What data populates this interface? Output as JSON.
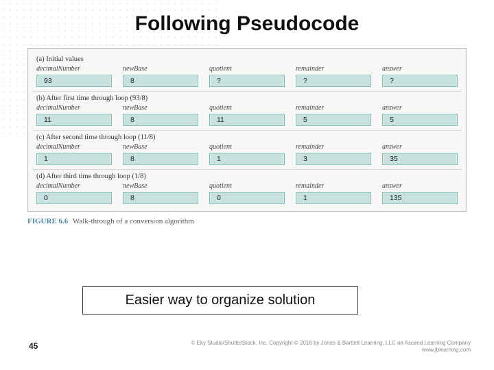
{
  "title": "Following Pseudocode",
  "figure": {
    "columns": [
      "decimalNumber",
      "newBase",
      "quotient",
      "remainder",
      "answer"
    ],
    "sections": [
      {
        "label": "(a) Initial values",
        "values": [
          "93",
          "8",
          "?",
          "?",
          "?"
        ]
      },
      {
        "label": "(b) After first time through loop (93/8)",
        "values": [
          "11",
          "8",
          "11",
          "5",
          "5"
        ]
      },
      {
        "label": "(c) After second time through loop (11/8)",
        "values": [
          "1",
          "8",
          "1",
          "3",
          "35"
        ]
      },
      {
        "label": "(d) After third time through loop (1/8)",
        "values": [
          "0",
          "8",
          "0",
          "1",
          "135"
        ]
      }
    ],
    "caption_num": "FIGURE 6.6",
    "caption_text": "Walk-through of a conversion algorithm"
  },
  "callout": "Easier way to organize solution",
  "page_number": "45",
  "copyright_line1": "© Eky Studio/ShutterStock, Inc. Copyright © 2016 by Jones & Bartlett Learning, LLC an Ascend Learning Company",
  "copyright_line2": "www.jblearning.com"
}
